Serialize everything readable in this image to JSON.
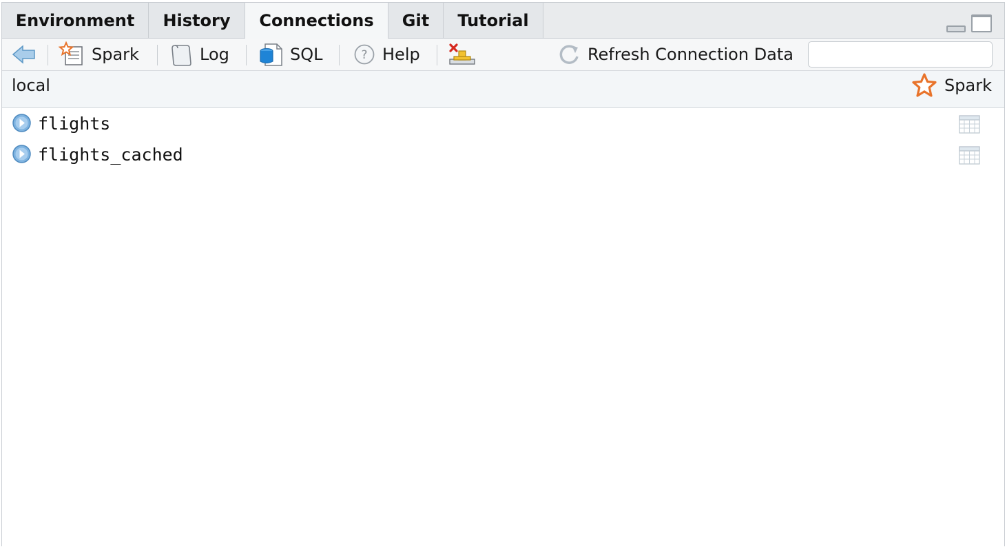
{
  "tabs": [
    {
      "label": "Environment",
      "active": false
    },
    {
      "label": "History",
      "active": false
    },
    {
      "label": "Connections",
      "active": true
    },
    {
      "label": "Git",
      "active": false
    },
    {
      "label": "Tutorial",
      "active": false
    }
  ],
  "toolbar": {
    "back_icon": "back-arrow-icon",
    "spark_label": "Spark",
    "log_label": "Log",
    "sql_label": "SQL",
    "help_label": "Help",
    "disconnect_icon": "disconnect-icon",
    "refresh_label": "Refresh Connection Data",
    "search_placeholder": ""
  },
  "connection": {
    "name": "local",
    "type_label": "Spark",
    "type_icon": "spark-star-icon",
    "accent_color": "#e8732a"
  },
  "objects": [
    {
      "name": "flights",
      "kind": "table"
    },
    {
      "name": "flights_cached",
      "kind": "table"
    }
  ]
}
